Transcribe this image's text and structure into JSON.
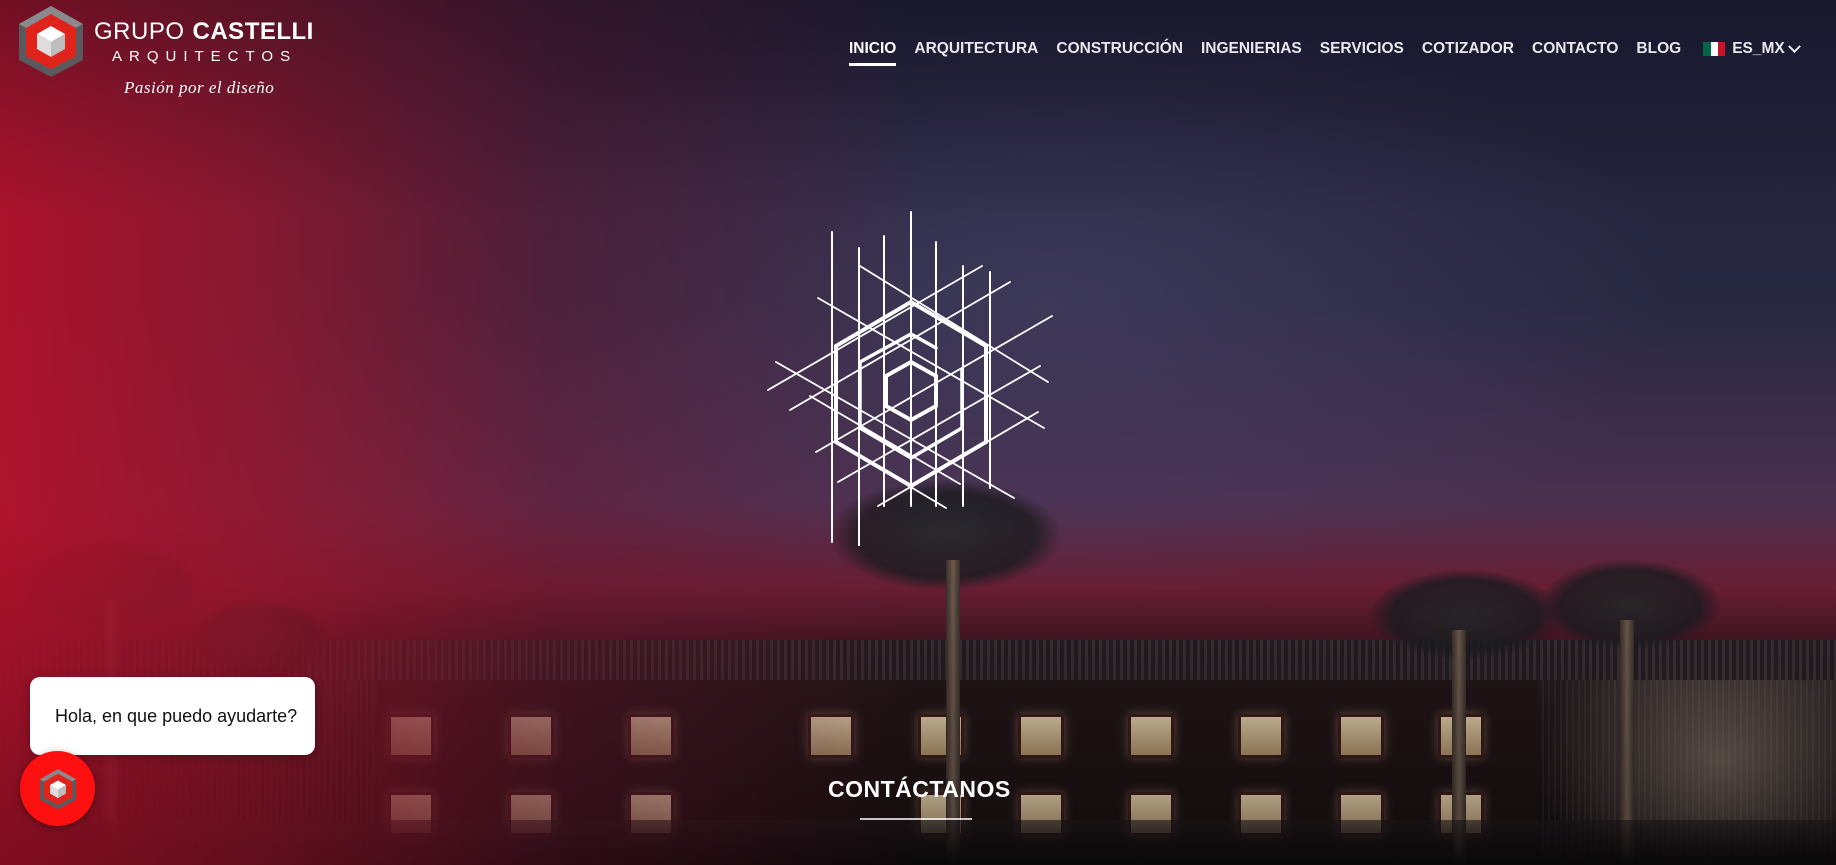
{
  "brand": {
    "name_light": "GRUPO",
    "name_bold": "CASTELLI",
    "subtitle": "ARQUITECTOS",
    "tagline": "Pasión por el diseño"
  },
  "nav": {
    "items": [
      {
        "label": "INICIO",
        "active": true
      },
      {
        "label": "ARQUITECTURA",
        "active": false
      },
      {
        "label": "CONSTRUCCIÓN",
        "active": false
      },
      {
        "label": "INGENIERIAS",
        "active": false
      },
      {
        "label": "SERVICIOS",
        "active": false
      },
      {
        "label": "COTIZADOR",
        "active": false
      },
      {
        "label": "CONTACTO",
        "active": false
      },
      {
        "label": "BLOG",
        "active": false
      }
    ],
    "language": {
      "label": "ES_MX",
      "flag_icon": "mexico-flag-icon"
    }
  },
  "hero": {
    "emblem_icon": "grupo-castelli-line-emblem-icon",
    "cta_label": "CONTÁCTANOS"
  },
  "chat": {
    "bubble_text": "Hola, en que puedo ayudarte?",
    "button_icon": "cube-logo-icon"
  },
  "colors": {
    "accent_red": "#ff1010",
    "brand_red": "#b2122c",
    "text": "#ffffff"
  }
}
